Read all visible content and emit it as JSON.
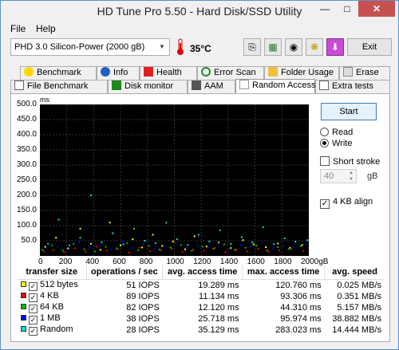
{
  "window": {
    "title": "HD Tune Pro 5.50 - Hard Disk/SSD Utility"
  },
  "menu": {
    "file": "File",
    "help": "Help"
  },
  "toolbar": {
    "drive": "PHD 3.0 Silicon-Power (2000 gB)",
    "temperature": "35°C",
    "exit_label": "Exit"
  },
  "tabs": {
    "row1": [
      "Benchmark",
      "Info",
      "Health",
      "Error Scan",
      "Folder Usage",
      "Erase"
    ],
    "row2": [
      "File Benchmark",
      "Disk monitor",
      "AAM",
      "Random Access",
      "Extra tests"
    ],
    "active": "Random Access"
  },
  "graph": {
    "unit_y": "ms",
    "y_ticks": [
      "500.0",
      "450.0",
      "400.0",
      "350.0",
      "300.0",
      "250.0",
      "200.0",
      "150.0",
      "100.0",
      "50.0"
    ],
    "x_ticks": [
      "0",
      "200",
      "400",
      "600",
      "800",
      "1000",
      "1200",
      "1400",
      "1600",
      "1800",
      "2000gB"
    ]
  },
  "controls": {
    "start_label": "Start",
    "read_label": "Read",
    "write_label": "Write",
    "mode": "write",
    "short_stroke_label": "Short stroke",
    "short_stroke_checked": false,
    "short_stroke_value": "40",
    "short_stroke_unit": "gB",
    "align_label": "4 KB align",
    "align_checked": true
  },
  "results": {
    "headers": [
      "transfer size",
      "operations / sec",
      "avg. access time",
      "max. access time",
      "avg. speed"
    ],
    "rows": [
      {
        "size": "512 bytes",
        "color": "#ffff00",
        "ops": "51 IOPS",
        "avg": "19.289 ms",
        "max": "120.760 ms",
        "speed": "0.025 MB/s"
      },
      {
        "size": "4 KB",
        "color": "#ff0000",
        "ops": "89 IOPS",
        "avg": "11.134 ms",
        "max": "93.306 ms",
        "speed": "0.351 MB/s"
      },
      {
        "size": "64 KB",
        "color": "#00c000",
        "ops": "82 IOPS",
        "avg": "12.120 ms",
        "max": "44.310 ms",
        "speed": "5.157 MB/s"
      },
      {
        "size": "1 MB",
        "color": "#0000ff",
        "ops": "38 IOPS",
        "avg": "25.718 ms",
        "max": "95.974 ms",
        "speed": "38.882 MB/s"
      },
      {
        "size": "Random",
        "color": "#00e0e0",
        "ops": "28 IOPS",
        "avg": "35.129 ms",
        "max": "283.023 ms",
        "speed": "14.444 MB/s"
      }
    ]
  },
  "chart_data": {
    "type": "scatter",
    "xlabel": "",
    "ylabel": "ms",
    "xlim": [
      0,
      2000
    ],
    "ylim": [
      0,
      500
    ],
    "series": [
      {
        "name": "512 bytes",
        "color": "#ffff00",
        "points": [
          [
            40,
            30
          ],
          [
            120,
            60
          ],
          [
            210,
            25
          ],
          [
            300,
            90
          ],
          [
            380,
            40
          ],
          [
            450,
            20
          ],
          [
            520,
            110
          ],
          [
            600,
            35
          ],
          [
            690,
            55
          ],
          [
            760,
            28
          ],
          [
            840,
            70
          ],
          [
            910,
            33
          ],
          [
            990,
            48
          ],
          [
            1080,
            22
          ],
          [
            1150,
            65
          ],
          [
            1240,
            31
          ],
          [
            1330,
            44
          ],
          [
            1420,
            26
          ],
          [
            1510,
            52
          ],
          [
            1590,
            38
          ],
          [
            1680,
            29
          ],
          [
            1770,
            41
          ],
          [
            1860,
            27
          ],
          [
            1950,
            36
          ]
        ]
      },
      {
        "name": "4 KB",
        "color": "#ff0000",
        "points": [
          [
            30,
            15
          ],
          [
            100,
            20
          ],
          [
            180,
            12
          ],
          [
            260,
            25
          ],
          [
            340,
            14
          ],
          [
            420,
            30
          ],
          [
            500,
            18
          ],
          [
            580,
            22
          ],
          [
            660,
            11
          ],
          [
            740,
            27
          ],
          [
            820,
            16
          ],
          [
            900,
            19
          ],
          [
            980,
            24
          ],
          [
            1060,
            13
          ],
          [
            1140,
            21
          ],
          [
            1220,
            17
          ],
          [
            1300,
            26
          ],
          [
            1380,
            12
          ],
          [
            1460,
            20
          ],
          [
            1540,
            15
          ],
          [
            1620,
            23
          ],
          [
            1700,
            14
          ],
          [
            1780,
            18
          ],
          [
            1870,
            22
          ],
          [
            1960,
            16
          ]
        ]
      },
      {
        "name": "64 KB",
        "color": "#00c000",
        "points": [
          [
            20,
            20
          ],
          [
            90,
            35
          ],
          [
            170,
            18
          ],
          [
            250,
            40
          ],
          [
            330,
            22
          ],
          [
            410,
            15
          ],
          [
            490,
            30
          ],
          [
            570,
            25
          ],
          [
            650,
            42
          ],
          [
            730,
            19
          ],
          [
            810,
            33
          ],
          [
            890,
            21
          ],
          [
            970,
            28
          ],
          [
            1050,
            36
          ],
          [
            1130,
            17
          ],
          [
            1210,
            31
          ],
          [
            1290,
            24
          ],
          [
            1370,
            38
          ],
          [
            1450,
            20
          ],
          [
            1530,
            27
          ],
          [
            1610,
            34
          ],
          [
            1690,
            18
          ],
          [
            1770,
            29
          ],
          [
            1850,
            23
          ],
          [
            1940,
            32
          ]
        ]
      },
      {
        "name": "1 MB",
        "color": "#0000ff",
        "points": [
          [
            50,
            25
          ],
          [
            130,
            30
          ],
          [
            210,
            20
          ],
          [
            290,
            45
          ],
          [
            370,
            28
          ],
          [
            450,
            35
          ],
          [
            530,
            22
          ],
          [
            610,
            50
          ],
          [
            690,
            26
          ],
          [
            770,
            38
          ],
          [
            850,
            24
          ],
          [
            930,
            31
          ],
          [
            1010,
            42
          ],
          [
            1090,
            27
          ],
          [
            1170,
            33
          ],
          [
            1250,
            29
          ],
          [
            1330,
            40
          ],
          [
            1410,
            23
          ],
          [
            1490,
            36
          ],
          [
            1570,
            30
          ],
          [
            1650,
            44
          ],
          [
            1730,
            25
          ],
          [
            1810,
            34
          ],
          [
            1890,
            28
          ],
          [
            1980,
            37
          ]
        ]
      },
      {
        "name": "Random",
        "color": "#00e0e0",
        "points": [
          [
            60,
            40
          ],
          [
            140,
            120
          ],
          [
            220,
            35
          ],
          [
            300,
            60
          ],
          [
            380,
            200
          ],
          [
            460,
            45
          ],
          [
            540,
            75
          ],
          [
            620,
            38
          ],
          [
            700,
            90
          ],
          [
            780,
            50
          ],
          [
            860,
            42
          ],
          [
            940,
            110
          ],
          [
            1020,
            55
          ],
          [
            1100,
            36
          ],
          [
            1180,
            70
          ],
          [
            1260,
            48
          ],
          [
            1340,
            85
          ],
          [
            1420,
            40
          ],
          [
            1500,
            62
          ],
          [
            1580,
            45
          ],
          [
            1660,
            95
          ],
          [
            1740,
            39
          ],
          [
            1820,
            58
          ],
          [
            1900,
            47
          ],
          [
            1990,
            52
          ]
        ]
      }
    ]
  }
}
